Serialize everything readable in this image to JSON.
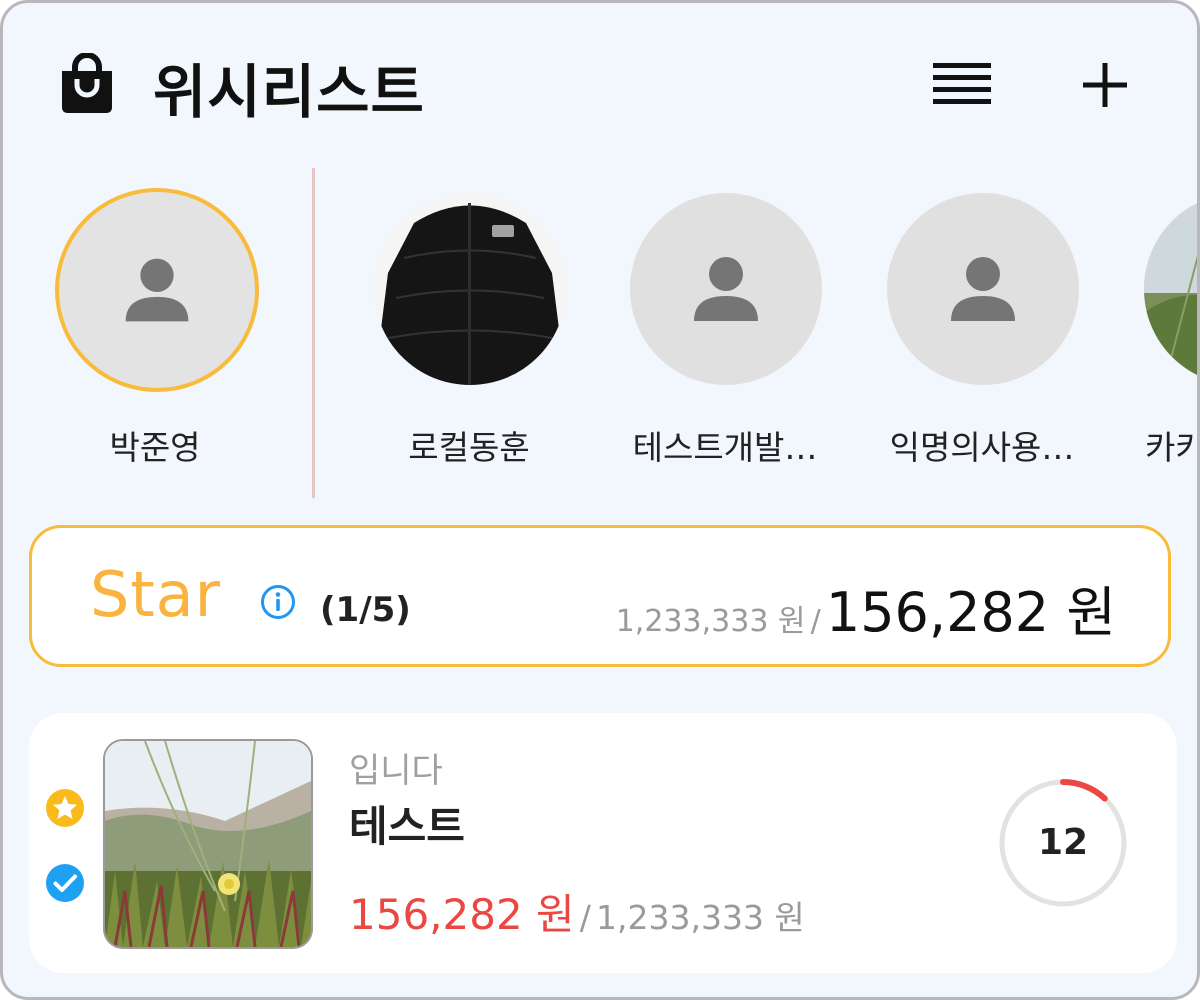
{
  "header": {
    "title": "위시리스트"
  },
  "friends": [
    {
      "name": "박준영",
      "avatar": "person-placeholder",
      "selected": true
    },
    {
      "name": "로컬동훈",
      "avatar": "black-puffer-jacket-photo",
      "selected": false
    },
    {
      "name": "테스트개발…",
      "avatar": "person-placeholder",
      "selected": false
    },
    {
      "name": "익명의사용…",
      "avatar": "person-placeholder",
      "selected": false
    },
    {
      "name": "카카",
      "avatar": "grass-photo",
      "selected": false
    }
  ],
  "star_summary": {
    "label": "Star",
    "count": "(1/5)",
    "target_price": "1,233,333 원",
    "separator": "/",
    "current_price": "156,282 원"
  },
  "items": [
    {
      "subtitle": "입니다",
      "name": "테스트",
      "price": "156,282 원",
      "separator": "/",
      "target_price": "1,233,333 원",
      "days_left": "12",
      "gauge_progress": 0.12,
      "starred": true,
      "checked": true
    }
  ],
  "colors": {
    "accent": "#f9bb3a",
    "price_red": "#ec4843",
    "check_blue": "#1ea1f2",
    "info_blue": "#2196f3",
    "background": "#f2f6fd"
  }
}
